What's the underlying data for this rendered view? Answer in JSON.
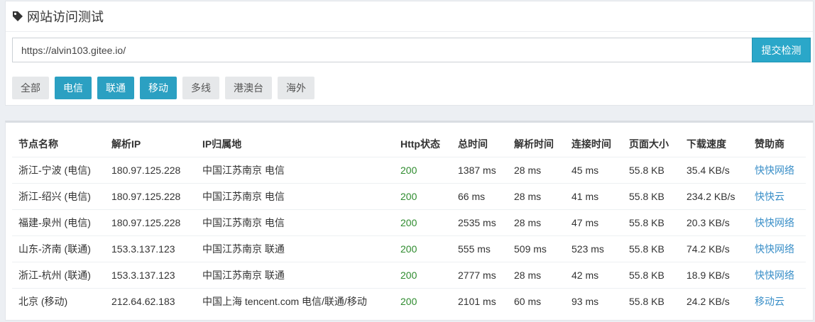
{
  "header": {
    "title": "网站访问测试",
    "icon": "tag-icon"
  },
  "form": {
    "url_value": "https://alvin103.gitee.io/",
    "submit_label": "提交检测"
  },
  "filters": [
    {
      "label": "全部",
      "active": false
    },
    {
      "label": "电信",
      "active": true
    },
    {
      "label": "联通",
      "active": true
    },
    {
      "label": "移动",
      "active": true
    },
    {
      "label": "多线",
      "active": false
    },
    {
      "label": "港澳台",
      "active": false
    },
    {
      "label": "海外",
      "active": false
    }
  ],
  "table": {
    "headers": [
      "节点名称",
      "解析IP",
      "IP归属地",
      "Http状态",
      "总时间",
      "解析时间",
      "连接时间",
      "页面大小",
      "下载速度",
      "赞助商"
    ],
    "rows": [
      [
        "浙江-宁波 (电信)",
        "180.97.125.228",
        "中国江苏南京 电信",
        "200",
        "1387 ms",
        "28 ms",
        "45 ms",
        "55.8 KB",
        "35.4 KB/s",
        "快快网络"
      ],
      [
        "浙江-绍兴 (电信)",
        "180.97.125.228",
        "中国江苏南京 电信",
        "200",
        "66 ms",
        "28 ms",
        "41 ms",
        "55.8 KB",
        "234.2 KB/s",
        "快快云"
      ],
      [
        "福建-泉州 (电信)",
        "180.97.125.228",
        "中国江苏南京 电信",
        "200",
        "2535 ms",
        "28 ms",
        "47 ms",
        "55.8 KB",
        "20.3 KB/s",
        "快快网络"
      ],
      [
        "山东-济南 (联通)",
        "153.3.137.123",
        "中国江苏南京 联通",
        "200",
        "555 ms",
        "509 ms",
        "523 ms",
        "55.8 KB",
        "74.2 KB/s",
        "快快网络"
      ],
      [
        "浙江-杭州 (联通)",
        "153.3.137.123",
        "中国江苏南京 联通",
        "200",
        "2777 ms",
        "28 ms",
        "42 ms",
        "55.8 KB",
        "18.9 KB/s",
        "快快网络"
      ],
      [
        "北京 (移动)",
        "212.64.62.183",
        "中国上海 tencent.com 电信/联通/移动",
        "200",
        "2101 ms",
        "60 ms",
        "93 ms",
        "55.8 KB",
        "24.2 KB/s",
        "移动云"
      ]
    ]
  },
  "colors": {
    "accent": "#2aa7c9",
    "status_ok": "#2e8b2e",
    "sponsor_link": "#3a8fc8"
  }
}
